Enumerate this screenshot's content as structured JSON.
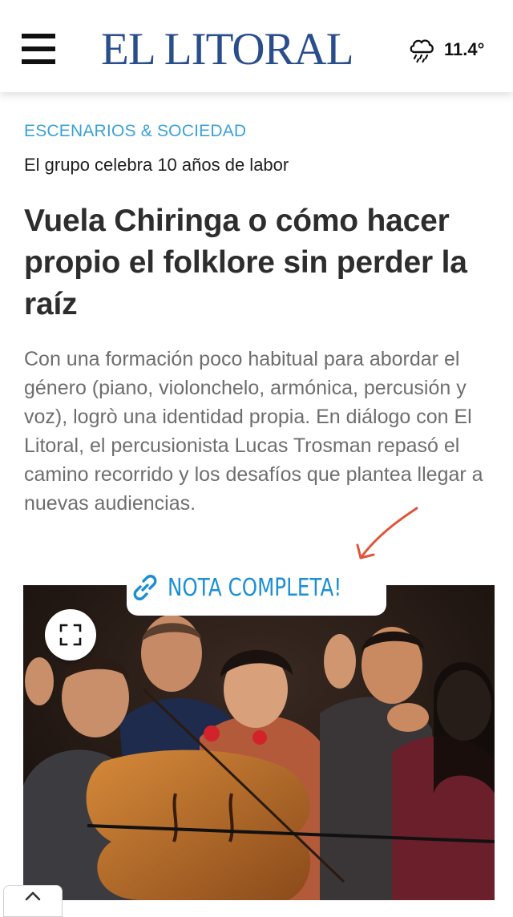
{
  "header": {
    "logo": "EL LITORAL",
    "temperature": "11.4°",
    "weather_icon": "cloud-rain-icon",
    "menu_icon": "hamburger-menu-icon"
  },
  "article": {
    "section": "ESCENARIOS & SOCIEDAD",
    "kicker": "El grupo celebra 10 años de labor",
    "headline": "Vuela Chiringa o cómo hacer propio el folklore sin perder la raíz",
    "lead": "Con una formación poco habitual para abordar el género (piano, violonchelo, armónica, percusión y voz), logrò una identidad propia. En diálogo con El Litoral, el percusionista Lucas Trosman repasó el camino recorrido y los desafíos que plantea llegar a nuevas audiencias."
  },
  "sticker": {
    "label": "NOTA COMPLETA!",
    "icon": "link-icon"
  },
  "photo": {
    "expand_icon": "expand-icon"
  },
  "footer": {
    "scroll_icon": "chevron-up-icon"
  },
  "colors": {
    "logo": "#2a4e8c",
    "section": "#3aa1d8",
    "sticker_text": "#1b8fd6",
    "arrow": "#e0553a"
  }
}
